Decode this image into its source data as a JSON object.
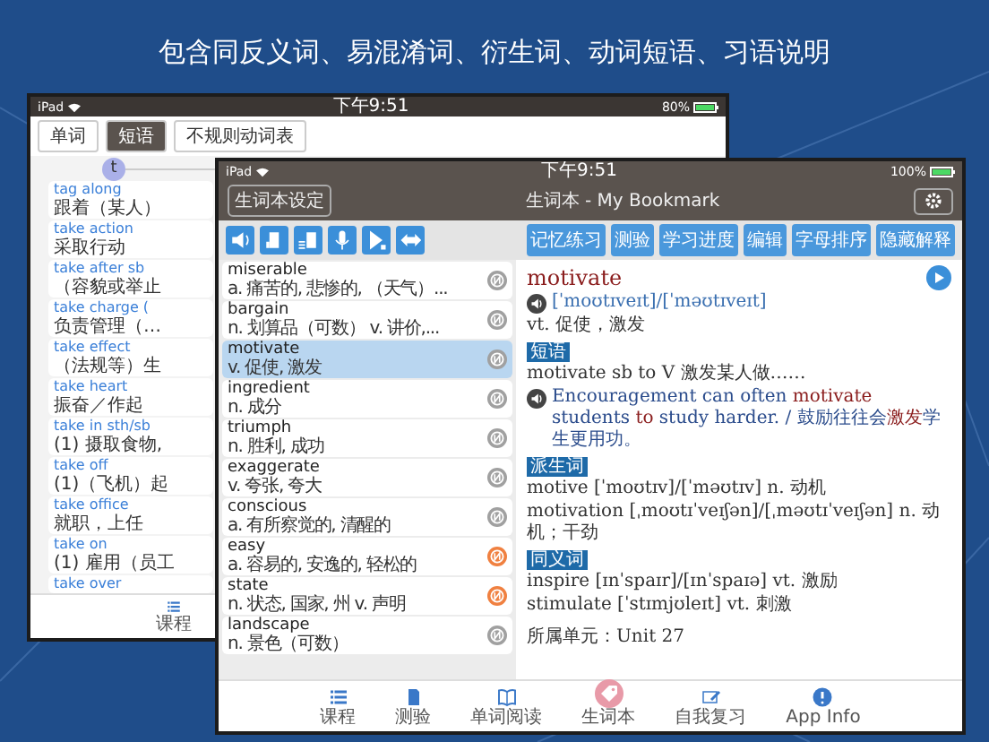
{
  "headline": "包含同反义词、易混淆词、衍生词、动词短语、习语说明",
  "back_window": {
    "status_bar": {
      "carrier": "iPad",
      "time": "下午9:51",
      "battery": "80%"
    },
    "tabs": [
      {
        "label": "单词",
        "selected": false
      },
      {
        "label": "短语",
        "selected": true
      },
      {
        "label": "不规则动词表",
        "selected": false
      }
    ],
    "index_letter": "t",
    "items": [
      {
        "term": "tag along",
        "meaning": "跟着（某人）"
      },
      {
        "term": "take action",
        "meaning": "采取行动"
      },
      {
        "term": "take after sb",
        "meaning": "（容貌或举止"
      },
      {
        "term": "take charge (",
        "meaning": "负责管理（…"
      },
      {
        "term": "take effect",
        "meaning": "（法规等）生"
      },
      {
        "term": "take heart",
        "meaning": "振奋／作起"
      },
      {
        "term": "take in sth/sb",
        "meaning": "(1) 摄取食物,"
      },
      {
        "term": "take off",
        "meaning": "(1)（飞机）起"
      },
      {
        "term": "take office",
        "meaning": "就职，上任"
      },
      {
        "term": "take on",
        "meaning": "(1) 雇用（员工"
      },
      {
        "term": "take over"
      }
    ],
    "tab_bar": [
      {
        "label": "课程"
      }
    ]
  },
  "front_window": {
    "status_bar": {
      "carrier": "iPad",
      "time": "下午9:51",
      "battery": "100%"
    },
    "nav_bar": {
      "left_button": "生词本设定",
      "title": "生词本 - My Bookmark"
    },
    "toolbar_buttons": [
      "记忆练习",
      "测验",
      "学习进度",
      "编辑",
      "字母排序",
      "隐藏解释"
    ],
    "words": [
      {
        "term": "miserable",
        "meaning": "a. 痛苦的, 悲惨的, （天气）...",
        "selected": false,
        "color": "#a0a0a0"
      },
      {
        "term": "bargain",
        "meaning": "n. 划算品（可数） v. 讲价,...",
        "selected": false,
        "color": "#a0a0a0"
      },
      {
        "term": "motivate",
        "meaning": "v. 促使, 激发",
        "selected": true,
        "color": "#a0a0a0"
      },
      {
        "term": "ingredient",
        "meaning": "n. 成分",
        "selected": false,
        "color": "#a0a0a0"
      },
      {
        "term": "triumph",
        "meaning": "n. 胜利, 成功",
        "selected": false,
        "color": "#a0a0a0"
      },
      {
        "term": "exaggerate",
        "meaning": "v. 夸张, 夸大",
        "selected": false,
        "color": "#a0a0a0"
      },
      {
        "term": "conscious",
        "meaning": "a. 有所察觉的, 清醒的",
        "selected": false,
        "color": "#a0a0a0"
      },
      {
        "term": "easy",
        "meaning": "a. 容易的, 安逸的, 轻松的",
        "selected": false,
        "color": "#f08040"
      },
      {
        "term": "state",
        "meaning": "n. 状态, 国家, 州  v. 声明",
        "selected": false,
        "color": "#f08040"
      },
      {
        "term": "landscape",
        "meaning": "n. 景色（可数）",
        "selected": false,
        "color": "#a0a0a0"
      }
    ],
    "detail": {
      "word": "motivate",
      "phonetic": "[ˈmoʊtɪveɪt]/[ˈməʊtɪveɪt]",
      "meaning": "vt. 促使，激发",
      "sections": [
        {
          "label": "短语",
          "lines": [
            {
              "text": "motivate sb to V  激发某人做……",
              "audio": false
            },
            {
              "text": "Encouragement can often **motivate** students **to** study harder. / 鼓励往往会**激发**学生更用功。",
              "audio": true
            }
          ]
        },
        {
          "label": "派生词",
          "lines": [
            {
              "text": "motive [ˈmoʊtɪv]/[ˈməʊtɪv] n. 动机",
              "audio": false
            },
            {
              "text": "motivation [ˌmoʊtɪˈveɪʃən]/[ˌməʊtɪˈveɪʃən] n. 动机；干劲",
              "audio": false
            }
          ]
        },
        {
          "label": "同义词",
          "lines": [
            {
              "text": "inspire [ɪnˈspaɪr]/[ɪnˈspaɪə] vt. 激励",
              "audio": false
            },
            {
              "text": "stimulate [ˈstɪmjʊleɪt] vt. 刺激",
              "audio": false
            }
          ]
        }
      ],
      "unit": "所属单元：Unit 27"
    },
    "tab_bar": [
      {
        "label": "课程",
        "selected": false
      },
      {
        "label": "测验",
        "selected": false
      },
      {
        "label": "单词阅读",
        "selected": false
      },
      {
        "label": "生词本",
        "selected": true
      },
      {
        "label": "自我复习",
        "selected": false
      },
      {
        "label": "App Info",
        "selected": false
      }
    ]
  }
}
